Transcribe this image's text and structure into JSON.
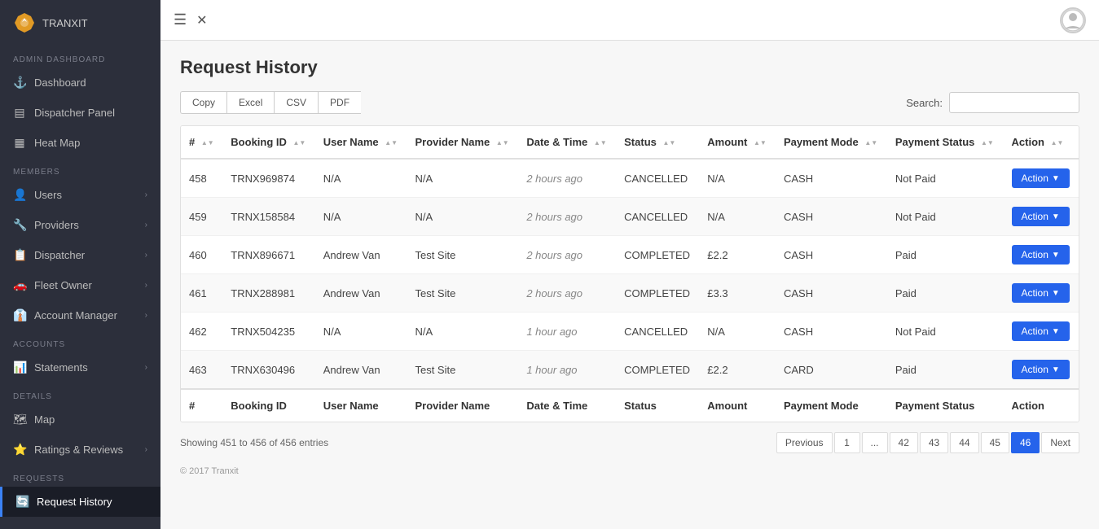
{
  "app": {
    "name": "TRANXIT",
    "copyright": "© 2017 Tranxit"
  },
  "sidebar": {
    "section_admin": "ADMIN DASHBOARD",
    "section_members": "MEMBERS",
    "section_accounts": "ACCOUNTS",
    "section_details": "DETAILS",
    "section_requests": "REQUESTS",
    "items": [
      {
        "id": "dashboard",
        "label": "Dashboard",
        "icon": "⚓",
        "hasArrow": false,
        "active": false
      },
      {
        "id": "dispatcher-panel",
        "label": "Dispatcher Panel",
        "icon": "▤",
        "hasArrow": false,
        "active": false
      },
      {
        "id": "heat-map",
        "label": "Heat Map",
        "icon": "▦",
        "hasArrow": false,
        "active": false
      },
      {
        "id": "users",
        "label": "Users",
        "icon": "👤",
        "hasArrow": true,
        "active": false
      },
      {
        "id": "providers",
        "label": "Providers",
        "icon": "🔧",
        "hasArrow": true,
        "active": false
      },
      {
        "id": "dispatcher",
        "label": "Dispatcher",
        "icon": "📋",
        "hasArrow": true,
        "active": false
      },
      {
        "id": "fleet-owner",
        "label": "Fleet Owner",
        "icon": "🚗",
        "hasArrow": true,
        "active": false
      },
      {
        "id": "account-manager",
        "label": "Account Manager",
        "icon": "👔",
        "hasArrow": true,
        "active": false
      },
      {
        "id": "statements",
        "label": "Statements",
        "icon": "📊",
        "hasArrow": true,
        "active": false
      },
      {
        "id": "map",
        "label": "Map",
        "icon": "🗺",
        "hasArrow": false,
        "active": false
      },
      {
        "id": "ratings-reviews",
        "label": "Ratings & Reviews",
        "icon": "⭐",
        "hasArrow": true,
        "active": false
      },
      {
        "id": "request-history",
        "label": "Request History",
        "icon": "🔄",
        "hasArrow": false,
        "active": true
      }
    ]
  },
  "page": {
    "title": "Request History"
  },
  "toolbar": {
    "buttons": [
      "Copy",
      "Excel",
      "CSV",
      "PDF"
    ],
    "search_label": "Search:",
    "search_placeholder": ""
  },
  "table": {
    "columns": [
      {
        "key": "#",
        "label": "#"
      },
      {
        "key": "booking_id",
        "label": "Booking ID"
      },
      {
        "key": "user_name",
        "label": "User Name"
      },
      {
        "key": "provider_name",
        "label": "Provider Name"
      },
      {
        "key": "date_time",
        "label": "Date & Time"
      },
      {
        "key": "status",
        "label": "Status"
      },
      {
        "key": "amount",
        "label": "Amount"
      },
      {
        "key": "payment_mode",
        "label": "Payment Mode"
      },
      {
        "key": "payment_status",
        "label": "Payment Status"
      },
      {
        "key": "action",
        "label": "Action"
      }
    ],
    "rows": [
      {
        "num": "458",
        "booking_id": "TRNX969874",
        "user_name": "N/A",
        "provider_name": "N/A",
        "date_time": "2 hours ago",
        "status": "CANCELLED",
        "amount": "N/A",
        "payment_mode": "CASH",
        "payment_status": "Not Paid",
        "action": "Action"
      },
      {
        "num": "459",
        "booking_id": "TRNX158584",
        "user_name": "N/A",
        "provider_name": "N/A",
        "date_time": "2 hours ago",
        "status": "CANCELLED",
        "amount": "N/A",
        "payment_mode": "CASH",
        "payment_status": "Not Paid",
        "action": "Action"
      },
      {
        "num": "460",
        "booking_id": "TRNX896671",
        "user_name": "Andrew Van",
        "provider_name": "Test Site",
        "date_time": "2 hours ago",
        "status": "COMPLETED",
        "amount": "£2.2",
        "payment_mode": "CASH",
        "payment_status": "Paid",
        "action": "Action"
      },
      {
        "num": "461",
        "booking_id": "TRNX288981",
        "user_name": "Andrew Van",
        "provider_name": "Test Site",
        "date_time": "2 hours ago",
        "status": "COMPLETED",
        "amount": "£3.3",
        "payment_mode": "CASH",
        "payment_status": "Paid",
        "action": "Action"
      },
      {
        "num": "462",
        "booking_id": "TRNX504235",
        "user_name": "N/A",
        "provider_name": "N/A",
        "date_time": "1 hour ago",
        "status": "CANCELLED",
        "amount": "N/A",
        "payment_mode": "CASH",
        "payment_status": "Not Paid",
        "action": "Action"
      },
      {
        "num": "463",
        "booking_id": "TRNX630496",
        "user_name": "Andrew Van",
        "provider_name": "Test Site",
        "date_time": "1 hour ago",
        "status": "COMPLETED",
        "amount": "£2.2",
        "payment_mode": "CARD",
        "payment_status": "Paid",
        "action": "Action"
      }
    ],
    "showing_text": "Showing 451 to 456 of 456 entries"
  },
  "pagination": {
    "prev_label": "Previous",
    "next_label": "Next",
    "pages": [
      "1",
      "...",
      "42",
      "43",
      "44",
      "45",
      "46"
    ],
    "active_page": "46"
  }
}
